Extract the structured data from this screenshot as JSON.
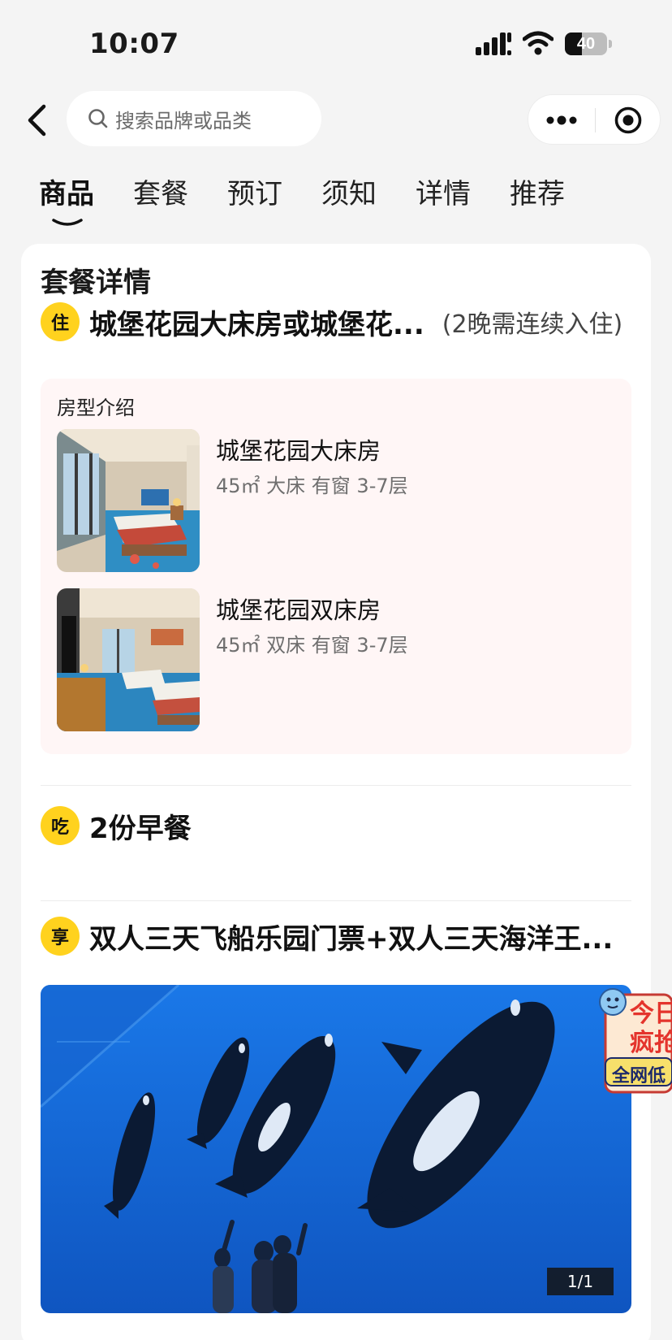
{
  "status_bar": {
    "time": "10:07",
    "battery": "40",
    "battery_level": 0.4
  },
  "search": {
    "placeholder": "搜索品牌或品类"
  },
  "tabs": [
    {
      "label": "商品",
      "active": true
    },
    {
      "label": "套餐",
      "active": false
    },
    {
      "label": "预订",
      "active": false
    },
    {
      "label": "须知",
      "active": false
    },
    {
      "label": "详情",
      "active": false
    },
    {
      "label": "推荐",
      "active": false
    }
  ],
  "package": {
    "section_title": "套餐详情",
    "stay": {
      "badge": "住",
      "title": "城堡花园大床房或城堡花...",
      "note": "(2晚需连续入住)",
      "intro_label": "房型介绍",
      "rooms": [
        {
          "name": "城堡花园大床房",
          "specs": "45㎡  大床  有窗  3-7层"
        },
        {
          "name": "城堡花园双床房",
          "specs": "45㎡  双床  有窗  3-7层"
        }
      ]
    },
    "meal": {
      "badge": "吃",
      "title": "2份早餐"
    },
    "enjoy": {
      "badge": "享",
      "title": "双人三天飞船乐园门票+双人三天海洋王...",
      "image_counter": "1/1"
    }
  },
  "promo": {
    "line1": "今日",
    "line2": "疯抢",
    "line3": "全网低"
  },
  "colors": {
    "badge": "#ffd21e",
    "room_panel_bg": "#fff6f6",
    "ocean": "#1a6fe0",
    "promo_red": "#e4342c"
  },
  "icons": [
    "back-icon",
    "search-icon",
    "more-icon",
    "close-target-icon",
    "signal-icon",
    "wifi-icon",
    "battery-icon",
    "mascot-icon"
  ]
}
